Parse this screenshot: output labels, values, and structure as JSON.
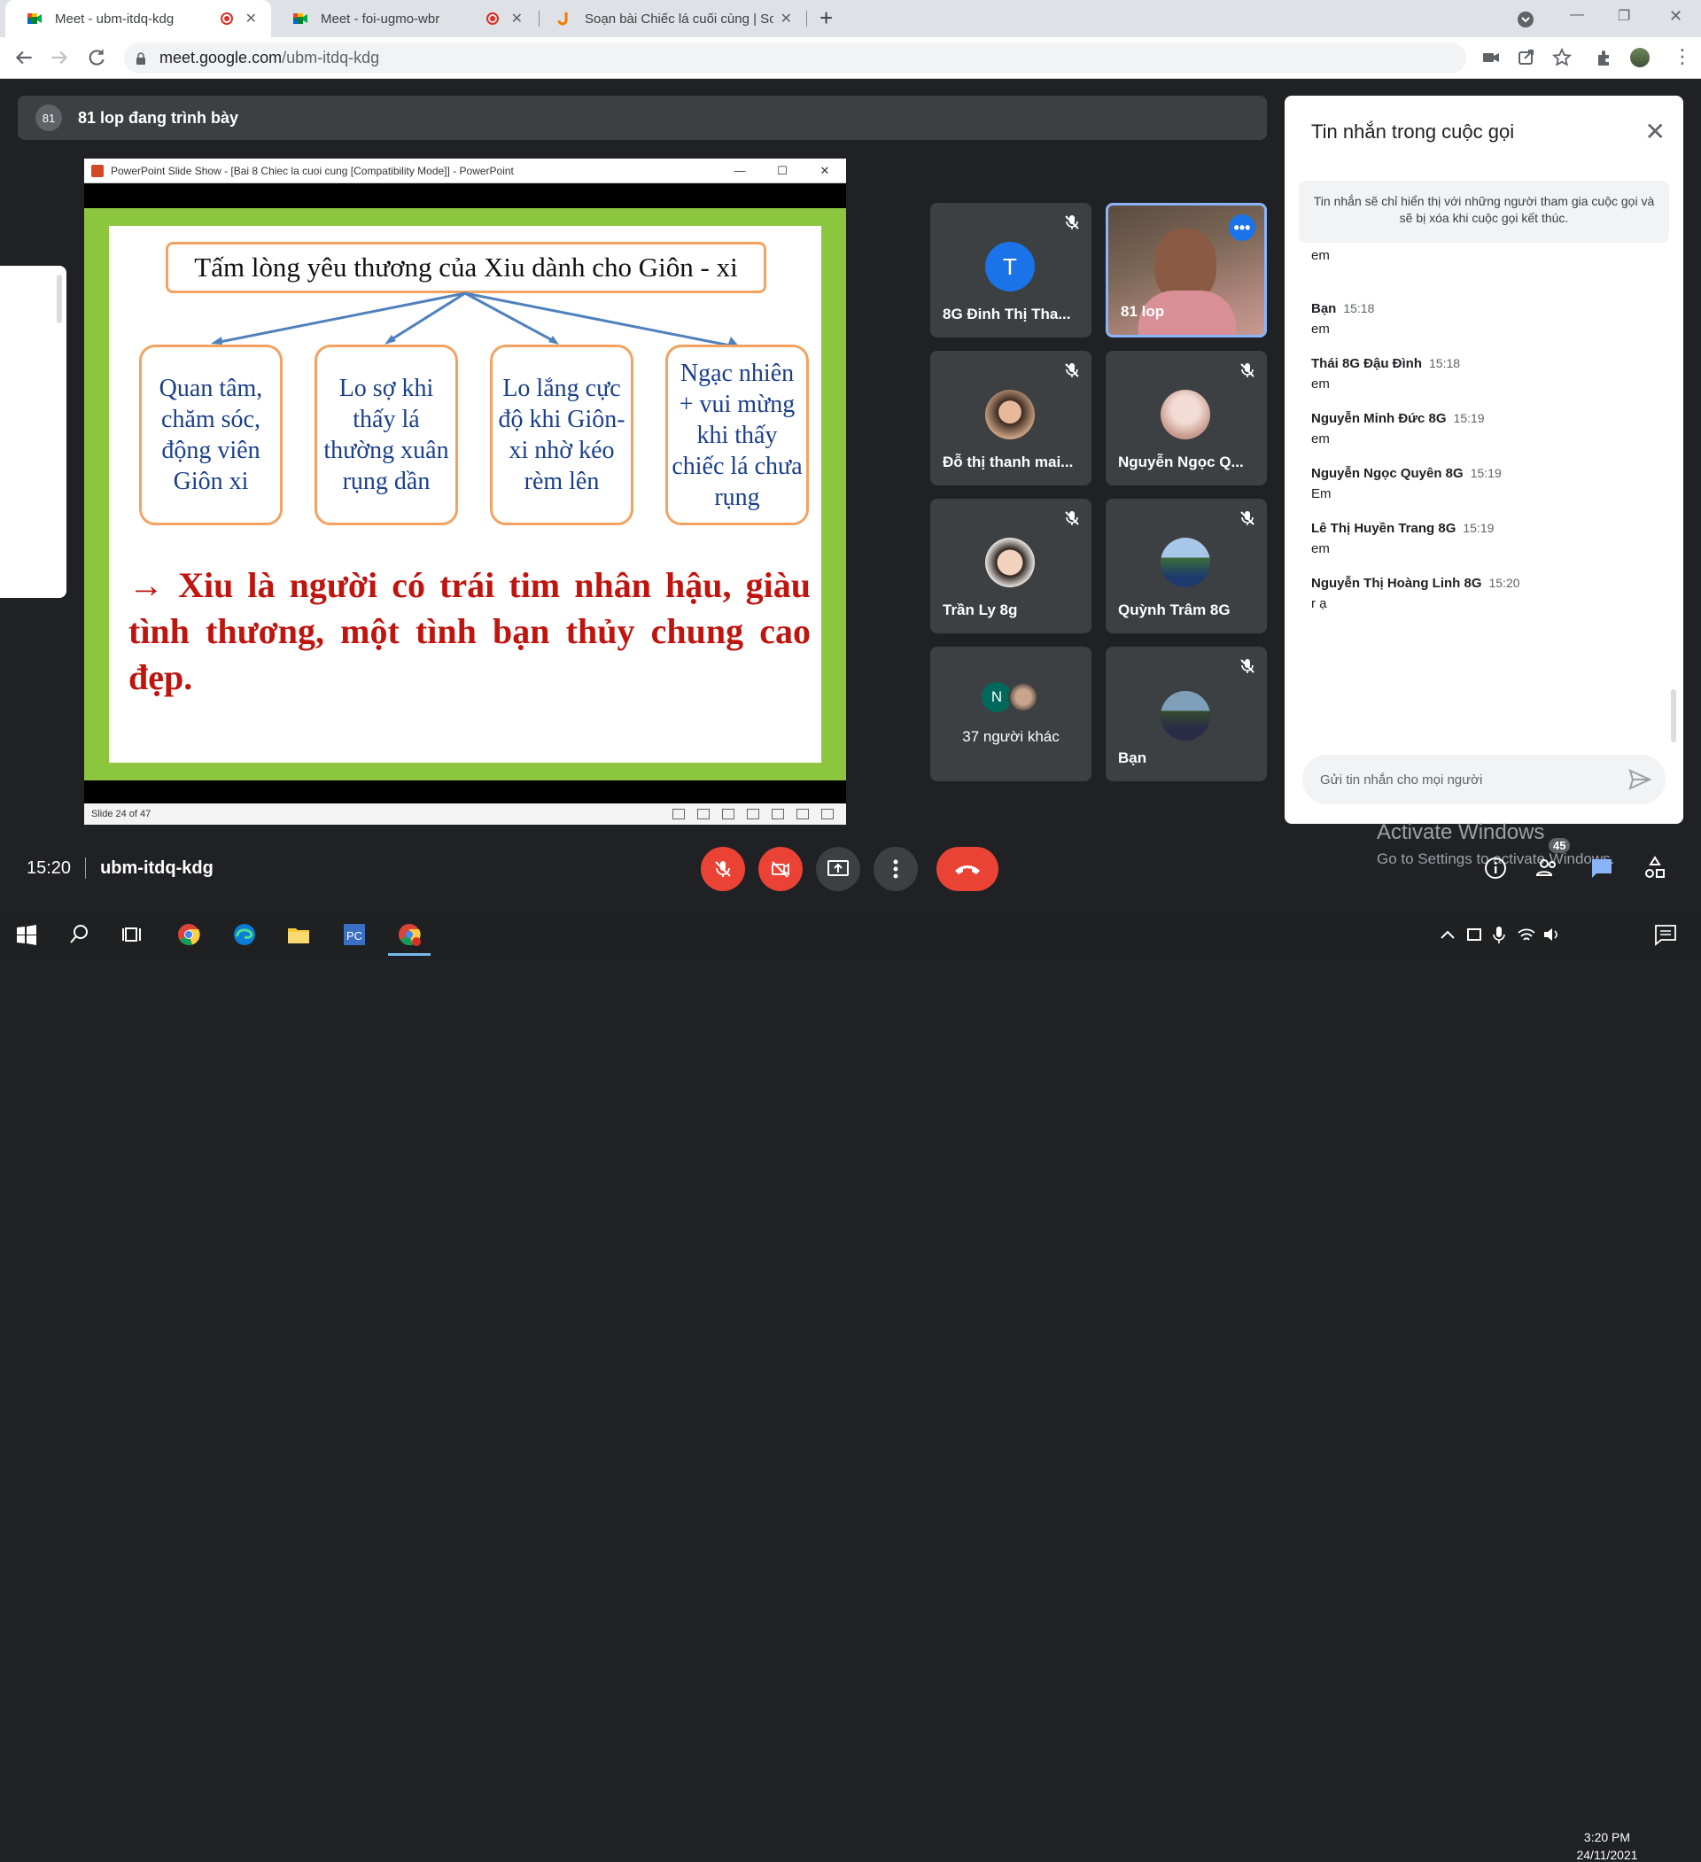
{
  "browser": {
    "tabs": [
      {
        "title": "Meet - ubm-itdq-kdg",
        "active": true,
        "recording": true
      },
      {
        "title": "Meet - foi-ugmo-wbr",
        "active": false,
        "recording": true
      },
      {
        "title": "Soạn bài Chiếc lá cuối cùng | Soạn",
        "active": false,
        "recording": false
      }
    ],
    "url_host": "meet.google.com",
    "url_path": "/ubm-itdq-kdg"
  },
  "presenting": {
    "avatar_text": "81",
    "text": "81 lop đang trình bày"
  },
  "powerpoint": {
    "window_title": "PowerPoint Slide Show - [Bai 8 Chiec la cuoi cung [Compatibility Mode]] - PowerPoint",
    "status": "Slide 24 of 47",
    "slide": {
      "heading": "Tấm lòng yêu thương của Xiu dành cho Giôn - xi",
      "boxes": [
        "Quan tâm, chăm sóc, động viên Giôn xi",
        "Lo sợ khi thấy lá thường xuân rụng dần",
        "Lo lắng cực độ khi Giôn-xi nhờ kéo rèm lên",
        "Ngạc nhiên + vui mừng khi thấy chiếc lá chưa rụng"
      ],
      "conclusion": "→  Xiu là  người có  trái tim nhân hậu, giàu tình thương, một tình bạn thủy chung cao đẹp."
    }
  },
  "participants": [
    {
      "name": "8G Đinh Thị Tha...",
      "avatar": "T",
      "muted": true
    },
    {
      "name": "81 lop",
      "avatar": "",
      "muted": false,
      "active": true
    },
    {
      "name": "Đỗ thị thanh mai...",
      "avatar": "",
      "muted": true
    },
    {
      "name": "Nguyễn Ngọc Q...",
      "avatar": "",
      "muted": true
    },
    {
      "name": "Trần Ly 8g",
      "avatar": "",
      "muted": true
    },
    {
      "name": "Quỳnh Trâm 8G",
      "avatar": "",
      "muted": true
    },
    {
      "name": "37 người khác",
      "avatar": "N",
      "muted": false
    },
    {
      "name": "Bạn",
      "avatar": "",
      "muted": true
    }
  ],
  "chat": {
    "title": "Tin nhắn trong cuộc gọi",
    "notice": "Tin nhắn sẽ chỉ hiển thị với những người tham gia cuộc gọi và sẽ bị xóa khi cuộc gọi kết thúc.",
    "partial_message": "em",
    "messages": [
      {
        "sender": "Bạn",
        "time": "15:18",
        "text": "em"
      },
      {
        "sender": "Thái 8G Đậu Đình",
        "time": "15:18",
        "text": "em"
      },
      {
        "sender": "Nguyễn Minh Đức 8G",
        "time": "15:19",
        "text": "em"
      },
      {
        "sender": "Nguyễn Ngọc Quyên 8G",
        "time": "15:19",
        "text": "Em"
      },
      {
        "sender": "Lê Thị Huyền Trang 8G",
        "time": "15:19",
        "text": "em"
      },
      {
        "sender": "Nguyễn Thị Hoàng Linh 8G",
        "time": "15:20",
        "text": "r ạ"
      }
    ],
    "input_placeholder": "Gửi tin nhắn cho mọi người"
  },
  "meeting": {
    "time": "15:20",
    "code": "ubm-itdq-kdg",
    "people_count": "45"
  },
  "watermark": {
    "line1": "Activate Windows",
    "line2": "Go to Settings to activate Windows."
  },
  "taskbar": {
    "time": "3:20 PM",
    "date": "24/11/2021"
  },
  "colors": {
    "meet_bg": "#202124",
    "tile_bg": "#3c4043",
    "danger": "#ea4335",
    "accent": "#1a73e8",
    "slide_green": "#8cc63f",
    "slide_text_blue": "#1a3f8b",
    "slide_text_red": "#c0150f",
    "box_border": "#f4a261"
  }
}
